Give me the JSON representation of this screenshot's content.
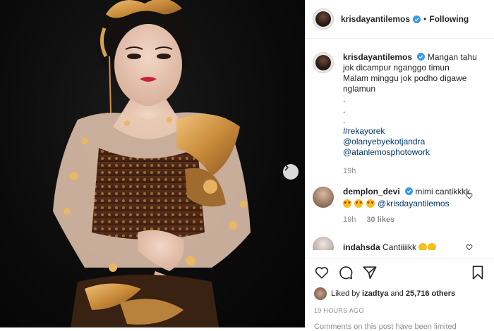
{
  "post": {
    "username": "krisdayantilemos",
    "following_label": "Following",
    "separator": "•"
  },
  "caption": {
    "username": "krisdayantilemos",
    "line1": "Mangan tahu jok dicampur nganggo timun",
    "line2": "Malam minggu jok podho digawe nglamun",
    "dots": [
      ".",
      ".",
      "."
    ],
    "tags": [
      "#rekayorek",
      "@olanyebyekotjandra",
      "@atanlemosphotowork"
    ],
    "time": "19h"
  },
  "comments": [
    {
      "username": "demplon_devi",
      "text": "mimi cantikkkk",
      "mention": "@krisdayantilemos",
      "time": "19h",
      "likes": "30 likes"
    },
    {
      "username": "indahsda",
      "text": "Cantiiiikk"
    }
  ],
  "likes": {
    "prefix": "Liked by",
    "user": "izadtya",
    "and": "and",
    "others": "25,716 others"
  },
  "timestamp": "19 HOURS AGO",
  "comments_limited": "Comments on this post have been limited",
  "icons": [
    "heart-icon",
    "comment-icon",
    "share-icon",
    "bookmark-icon",
    "next-arrow-icon",
    "verified-icon"
  ],
  "colors": {
    "link": "#00376b",
    "muted": "#8e8e8e",
    "verified": "#3897f0",
    "text": "#262626"
  }
}
